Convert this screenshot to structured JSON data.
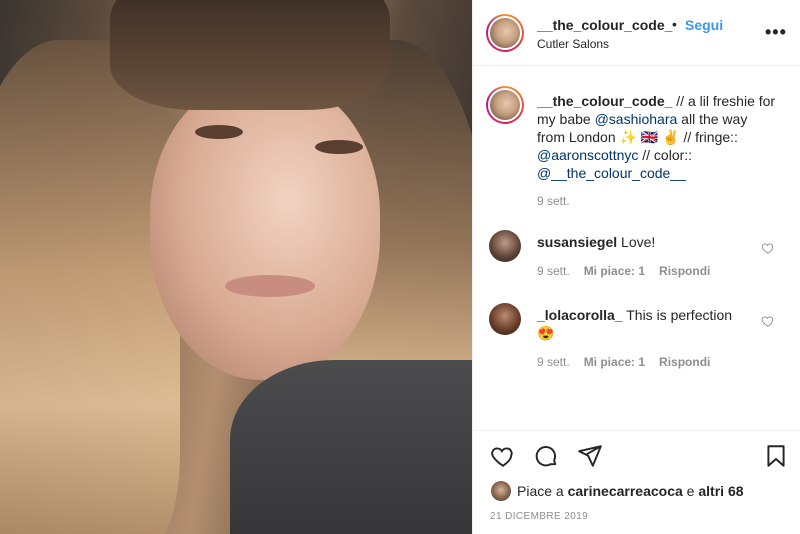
{
  "header": {
    "username": "__the_colour_code_",
    "separator": "•",
    "follow_label": "Segui",
    "location": "Cutler Salons",
    "more_label": "•••"
  },
  "caption": {
    "username": "__the_colour_code_",
    "text_part1": " // a lil freshie for my babe ",
    "mention1": "@sashiohara",
    "text_part2": " all the way from London ✨ 🇬🇧 ✌️ // fringe:: ",
    "mention2": "@aaronscottnyc",
    "text_part3": " // color:: ",
    "mention3": "@__the_colour_code__",
    "time": "9 sett."
  },
  "comments": [
    {
      "username": "susansiegel",
      "text": " Love!",
      "time": "9 sett.",
      "likes": "Mi piace: 1",
      "reply": "Rispondi"
    },
    {
      "username": "_lolacorolla_",
      "text": " This is perfection 😍",
      "time": "9 sett.",
      "likes": "Mi piace: 1",
      "reply": "Rispondi"
    }
  ],
  "actions": {
    "likes_prefix": "Piace a ",
    "likes_user": "carinecarreacoca",
    "likes_and": " e ",
    "likes_others": "altri 68",
    "date": "21 DICEMBRE 2019"
  }
}
